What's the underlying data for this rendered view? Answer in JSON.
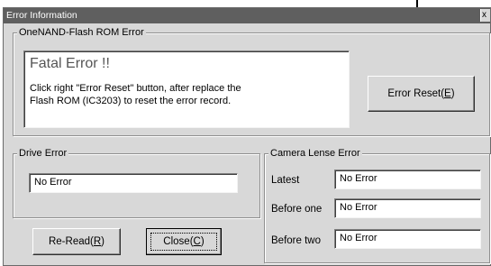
{
  "window": {
    "title": "Error Information",
    "close_glyph": "x"
  },
  "onenand": {
    "legend": "OneNAND-Flash ROM Error",
    "heading": "Fatal Error !!",
    "message_line1": "Click right \"Error Reset\" button, after replace the",
    "message_line2": "Flash ROM (IC3203) to reset the error record.",
    "reset_label": "Error Reset(",
    "reset_key": "E",
    "reset_tail": ")"
  },
  "drive": {
    "legend": "Drive Error",
    "value": "No Error"
  },
  "camera": {
    "legend": "Camera Lense Error",
    "rows": [
      {
        "label": "Latest",
        "value": "No Error"
      },
      {
        "label": "Before one",
        "value": "No Error"
      },
      {
        "label": "Before two",
        "value": "No Error"
      }
    ]
  },
  "buttons": {
    "reread_label": "Re-Read(",
    "reread_key": "R",
    "reread_tail": ")",
    "close_label": "Close(",
    "close_key": "C",
    "close_tail": ")"
  }
}
